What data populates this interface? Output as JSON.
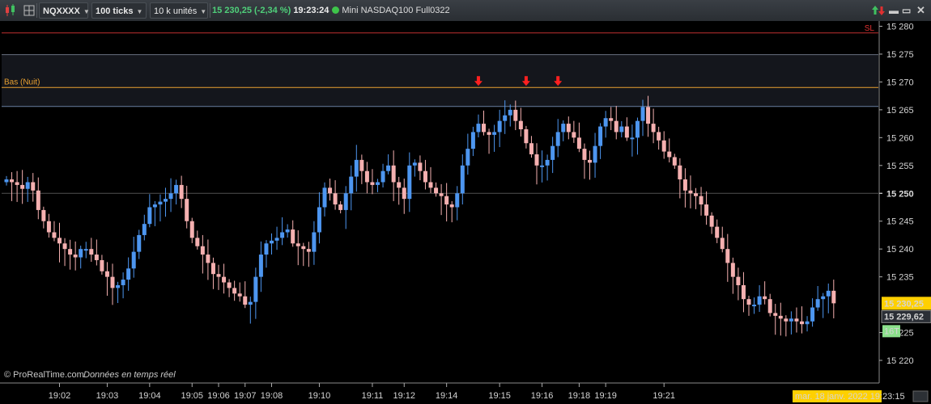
{
  "toolbar": {
    "symbol": "NQXXXX",
    "interval": "100 ticks",
    "units": "10 k unités",
    "price": "15 230,25",
    "change": "(-2,34 %)",
    "time": "19:23:24",
    "instrument": "Mini NASDAQ100 Full0322",
    "colors": {
      "up": "#4fd07a",
      "status_dot": "#3ec44a"
    },
    "icons": [
      "candlestick-icon",
      "grid-icon",
      "link-icon",
      "price-arrows-icon",
      "minimize-icon",
      "maximize-icon",
      "close-icon"
    ]
  },
  "overlay": {
    "sl_label": "SL",
    "bas_label": "Bas (Nuit)",
    "watermark": "© ProRealTime.com",
    "watermark_sub": "Données en temps réel",
    "arrow_marker_color": "#ff2020",
    "arrow_marker_bars": [
      89,
      98,
      104
    ]
  },
  "chart_data": {
    "type": "candlestick",
    "ylim": [
      15217.5,
      15282.5
    ],
    "y_ticks": [
      15280,
      15275,
      15270,
      15265,
      15260,
      15255,
      15250,
      15245,
      15240,
      15235,
      15225,
      15220
    ],
    "y_tick_labels": [
      "15 280",
      "15 275",
      "15 270",
      "15 265",
      "15 260",
      "15 255",
      "15 250",
      "15 245",
      "15 240",
      "15 235",
      "15 225",
      "15 220"
    ],
    "y_highlight_tick": {
      "value": 15250,
      "label": "15 250"
    },
    "last_price": {
      "value": 15230.25,
      "label": "15 230,25",
      "color": "#ffd000"
    },
    "bid_price": {
      "value": 15229.62,
      "label": "15 229,62"
    },
    "tag": {
      "label": "16T",
      "color": "#8be08b"
    },
    "date_badge": "mar. 18 janv. 2022 19:23:15",
    "x_tick_labels": [
      {
        "bar": 10,
        "label": "19:02"
      },
      {
        "bar": 19,
        "label": "19:03"
      },
      {
        "bar": 27,
        "label": "19:04"
      },
      {
        "bar": 35,
        "label": "19:05"
      },
      {
        "bar": 40,
        "label": "19:06"
      },
      {
        "bar": 45,
        "label": "19:07"
      },
      {
        "bar": 50,
        "label": "19:08"
      },
      {
        "bar": 59,
        "label": "19:10"
      },
      {
        "bar": 69,
        "label": "19:11"
      },
      {
        "bar": 75,
        "label": "19:12"
      },
      {
        "bar": 83,
        "label": "19:14"
      },
      {
        "bar": 93,
        "label": "19:15"
      },
      {
        "bar": 101,
        "label": "19:16"
      },
      {
        "bar": 108,
        "label": "19:18"
      },
      {
        "bar": 113,
        "label": "19:19"
      },
      {
        "bar": 124,
        "label": "19:21"
      }
    ],
    "levels": [
      {
        "name": "SL",
        "value": 15278.8,
        "color": "#c03030"
      },
      {
        "name": "zone-top",
        "value": 15274.9,
        "color": "#6a7080"
      },
      {
        "name": "Bas (Nuit)",
        "value": 15269.0,
        "color": "#e8a030"
      },
      {
        "name": "zone-bottom",
        "value": 15265.6,
        "color": "#6a7fa0"
      },
      {
        "name": "mid",
        "value": 15250.0,
        "color": "#505050"
      }
    ],
    "up_color": "#4d96f0",
    "down_color": "#f5b0b0",
    "close_path": [
      15252.5,
      15252.0,
      15251.5,
      15250.8,
      15252.0,
      15250.5,
      15247.0,
      15245.0,
      15243.0,
      15242.0,
      15241.0,
      15240.0,
      15239.0,
      15238.5,
      15240.0,
      15240.0,
      15239.0,
      15238.0,
      15236.0,
      15235.0,
      15233.0,
      15233.5,
      15234.5,
      15236.5,
      15239.5,
      15242.5,
      15244.5,
      15247.5,
      15248.0,
      15248.5,
      15249.0,
      15250.0,
      15251.5,
      15249.0,
      15245.0,
      15242.0,
      15240.5,
      15239.0,
      15237.5,
      15235.5,
      15235.0,
      15234.0,
      15233.0,
      15232.0,
      15231.5,
      15230.0,
      15230.5,
      15235.0,
      15239.0,
      15241.0,
      15241.5,
      15242.0,
      15243.0,
      15243.5,
      15241.0,
      15240.5,
      15240.0,
      15239.5,
      15243.0,
      15247.5,
      15251.0,
      15250.0,
      15248.0,
      15247.0,
      15250.0,
      15253.0,
      15256.0,
      15254.0,
      15252.0,
      15251.5,
      15252.0,
      15254.0,
      15255.0,
      15252.0,
      15251.0,
      15249.0,
      15255.0,
      15255.5,
      15254.0,
      15252.0,
      15251.0,
      15250.0,
      15249.5,
      15248.0,
      15247.5,
      15250.0,
      15255.0,
      15258.0,
      15261.0,
      15262.5,
      15261.0,
      15260.5,
      15261.0,
      15263.0,
      15264.0,
      15265.0,
      15263.0,
      15261.5,
      15259.0,
      15257.0,
      15255.0,
      15255.0,
      15256.0,
      15258.5,
      15261.0,
      15262.5,
      15261.0,
      15260.0,
      15258.0,
      15256.0,
      15255.5,
      15258.5,
      15262.0,
      15263.5,
      15263.0,
      15261.0,
      15262.0,
      15260.0,
      15260.0,
      15263.0,
      15265.5,
      15262.5,
      15261.0,
      15259.5,
      15257.5,
      15256.5,
      15255.0,
      15252.5,
      15250.5,
      15250.0,
      15249.5,
      15248.0,
      15246.0,
      15244.0,
      15242.0,
      15240.0,
      15237.5,
      15235.0,
      15233.5,
      15231.0,
      15230.0,
      15230.0,
      15231.5,
      15231.0,
      15228.5,
      15228.0,
      15227.5,
      15227.0,
      15227.5,
      15227.0,
      15226.5,
      15227.0,
      15229.5,
      15231.0,
      15231.5,
      15232.5,
      15230.25
    ],
    "x_label": "",
    "y_label": "",
    "grid": false
  }
}
